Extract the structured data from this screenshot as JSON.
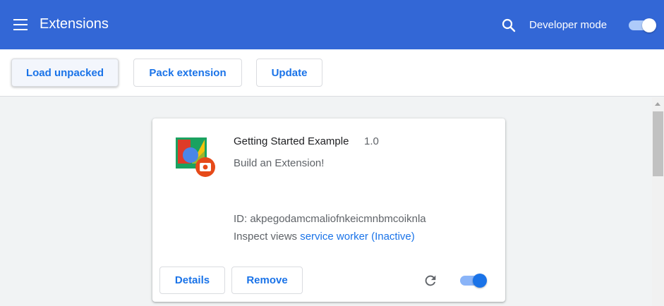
{
  "header": {
    "title": "Extensions",
    "search_icon": "search-icon",
    "menu_icon": "hamburger-menu-icon",
    "developer_mode_label": "Developer mode",
    "developer_mode_on": true
  },
  "toolbar": {
    "load_unpacked_label": "Load unpacked",
    "pack_extension_label": "Pack extension",
    "update_label": "Update"
  },
  "extension": {
    "name": "Getting Started Example",
    "version": "1.0",
    "description": "Build an Extension!",
    "id_text": "ID: akpegodamcmaliofnkeicmnbmcoiknla",
    "inspect_label": "Inspect views",
    "inspect_link": "service worker (Inactive)",
    "details_label": "Details",
    "remove_label": "Remove",
    "reload_icon": "reload-icon",
    "enabled": true
  },
  "colors": {
    "header_bg": "#3367d6",
    "accent": "#1a73e8",
    "page_bg": "#f1f3f4"
  }
}
